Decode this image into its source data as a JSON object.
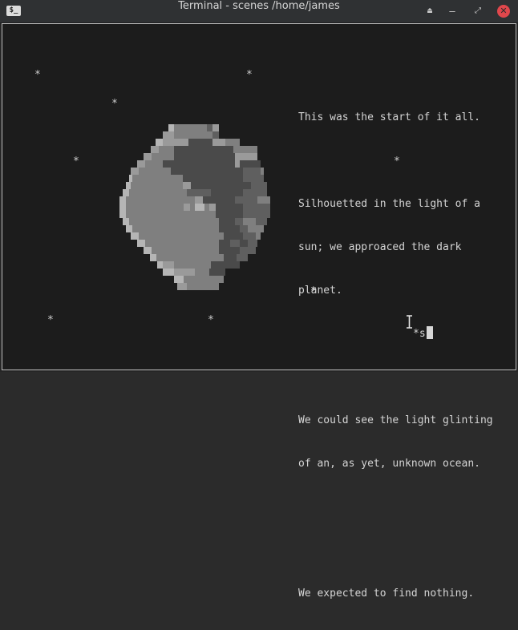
{
  "window": {
    "title": "Terminal - scenes /home/james",
    "app_icon": "$_",
    "controls": {
      "eject": "⏏",
      "minimize": "–",
      "maximize": "⤢",
      "close": "✕"
    }
  },
  "terminal": {
    "star_char": "*",
    "lines": {
      "p1": "This was the start of it all.",
      "p2a": "Silhouetted in the light of a",
      "p2b": "sun; we approaced the dark",
      "p2c": "planet.",
      "p3a": "We could see the light glinting",
      "p3b": "of an, as yet, unknown ocean.",
      "p4": "We expected to find nothing."
    },
    "prompt_text": "*s"
  },
  "colors": {
    "terminal_bg": "#1c1c1c",
    "text": "#d4d4d4",
    "close_button": "#e0474c"
  }
}
